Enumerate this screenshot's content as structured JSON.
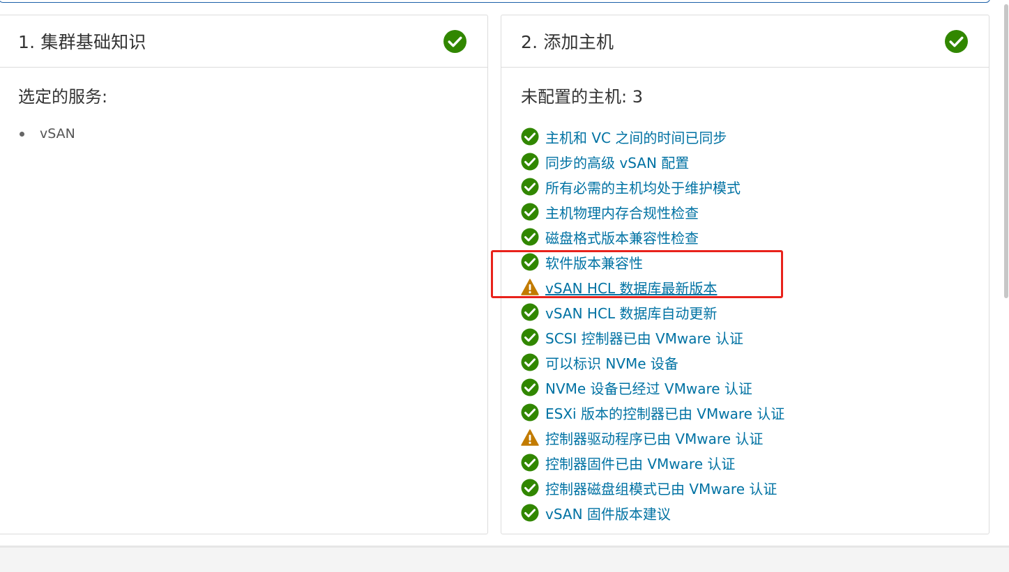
{
  "steps": [
    {
      "title": "1. 集群基础知识",
      "status": "ok",
      "section_title": "选定的服务:",
      "services": [
        "vSAN"
      ]
    },
    {
      "title": "2. 添加主机",
      "status": "ok",
      "section_title": "未配置的主机: 3",
      "checks": [
        {
          "label": "主机和 VC 之间的时间已同步",
          "status": "ok"
        },
        {
          "label": "同步的高级 vSAN 配置",
          "status": "ok"
        },
        {
          "label": "所有必需的主机均处于维护模式",
          "status": "ok"
        },
        {
          "label": "主机物理内存合规性检查",
          "status": "ok"
        },
        {
          "label": "磁盘格式版本兼容性检查",
          "status": "ok"
        },
        {
          "label": "软件版本兼容性",
          "status": "ok"
        },
        {
          "label": "vSAN HCL 数据库最新版本",
          "status": "warning"
        },
        {
          "label": "vSAN HCL 数据库自动更新",
          "status": "ok"
        },
        {
          "label": "SCSI 控制器已由 VMware 认证",
          "status": "ok"
        },
        {
          "label": "可以标识 NVMe 设备",
          "status": "ok"
        },
        {
          "label": "NVMe 设备已经过 VMware 认证",
          "status": "ok"
        },
        {
          "label": "ESXi 版本的控制器已由 VMware 认证",
          "status": "ok"
        },
        {
          "label": "控制器驱动程序已由 VMware 认证",
          "status": "warning"
        },
        {
          "label": "控制器固件已由 VMware 认证",
          "status": "ok"
        },
        {
          "label": "控制器磁盘组模式已由 VMware 认证",
          "status": "ok"
        },
        {
          "label": "vSAN 固件版本建议",
          "status": "ok"
        }
      ]
    }
  ],
  "colors": {
    "ok": "#318700",
    "warning": "#c27b00",
    "link": "#0072a3",
    "highlight": "#e8221b"
  },
  "icons": {
    "ok": "check-circle-icon",
    "warning": "warning-triangle-icon"
  }
}
